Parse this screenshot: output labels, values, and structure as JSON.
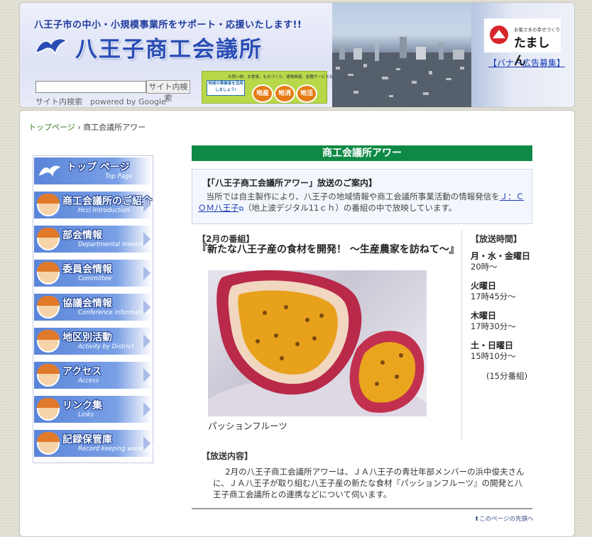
{
  "header": {
    "tagline": "八王子市の中小・小規模事業所をサポート・応援いたします!!",
    "site_name": "八王子商工会議所",
    "search": {
      "placeholder": "",
      "button_label": "サイト内検索",
      "caption": "サイト内検索　powered by Google"
    },
    "chisan_banner": {
      "small_text": "お買い物、お食事、ものづくり、建物関連、各種サービスなどの",
      "note": "地域の事業者を活用しましょう!",
      "buttons": [
        "地産",
        "地消",
        "地活"
      ]
    },
    "tamashin": {
      "small_text": "お客さまの幸せづくり",
      "name": "たましん"
    },
    "banner_ad_link": "【バナー広告募集】"
  },
  "breadcrumb": {
    "home": "トップページ",
    "separator": "›",
    "current": "商工会議所アワー"
  },
  "sidebar": {
    "items": [
      {
        "jp": "トップ ページ",
        "en": "Top Page"
      },
      {
        "jp": "商工会議所のご紹介",
        "en": "Hcci Introduction"
      },
      {
        "jp": "部会情報",
        "en": "Departmental meeting"
      },
      {
        "jp": "委員会情報",
        "en": "Committee"
      },
      {
        "jp": "協議会情報",
        "en": "Conference information"
      },
      {
        "jp": "地区別活動",
        "en": "Activity by District"
      },
      {
        "jp": "アクセス",
        "en": "Access"
      },
      {
        "jp": "リンク集",
        "en": "Links"
      },
      {
        "jp": "記録保管庫",
        "en": "Record keeping warehouse"
      }
    ]
  },
  "content": {
    "title": "商工会議所アワー",
    "notice": {
      "title": "【「八王子商工会議所アワー」放送のご案内】",
      "body_before": "当所では自主製作により、八王子の地域情報や商工会議所事業活動の情報発信を",
      "link": "Ｊ：ＣＯＭ八王子",
      "body_after": "（地上波デジタル11ｃｈ）の番組の中で放映しています。"
    },
    "program": {
      "label": "【2月の番組】",
      "title": "『新たな八王子産の食材を開発！ ～生産農家を訪ねて～』",
      "photo_caption": "パッションフルーツ"
    },
    "schedule": {
      "title": "【放送時間】",
      "slots": [
        {
          "day": "月・水・金曜日",
          "time": "20時～"
        },
        {
          "day": "火曜日",
          "time": "17時45分～"
        },
        {
          "day": "木曜日",
          "time": "17時30分～"
        },
        {
          "day": "土・日曜日",
          "time": "15時10分～"
        }
      ],
      "note": "(15分番組)"
    },
    "broadcast": {
      "title": "【放送内容】",
      "body": "2月の八王子商工会議所アワーは、ＪＡ八王子の青壮年部メンバーの浜中俊夫さんに、ＪＡ八王子が取り組む八王子産の新たな食材『パッションフルーツ』の開発と八王子商工会議所との連携などについて伺います。"
    },
    "back_to_top": "このページの先頭へ"
  },
  "colors": {
    "title_bar": "#0f8a46",
    "link_blue": "#1a3bb8",
    "breadcrumb_green": "#3b7d27"
  }
}
